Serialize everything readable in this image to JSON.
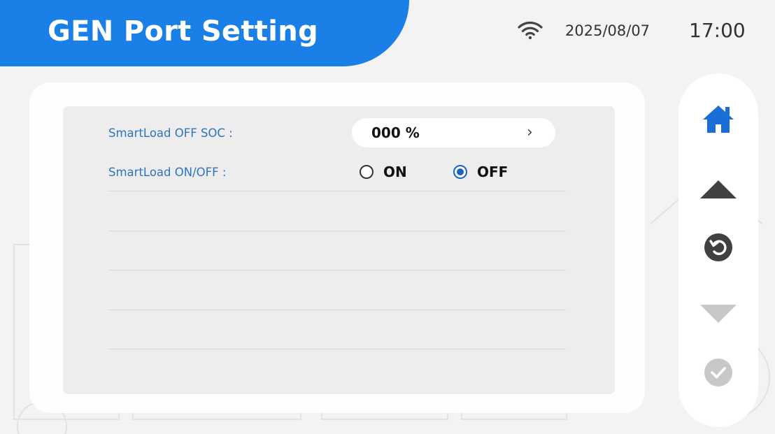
{
  "header": {
    "title": "GEN Port Setting"
  },
  "status": {
    "wifi_icon": "wifi-icon",
    "date": "2025/08/07",
    "time": "17:00"
  },
  "settings": {
    "smartload_off_soc": {
      "label": "SmartLoad OFF SOC :",
      "value": "000 %"
    },
    "smartload_onoff": {
      "label": "SmartLoad ON/OFF :",
      "options": [
        {
          "label": "ON",
          "selected": false
        },
        {
          "label": "OFF",
          "selected": true
        }
      ]
    }
  },
  "nav": {
    "home_icon": "home-icon",
    "up_icon": "triangle-up-icon",
    "back_icon": "back-icon",
    "down_icon": "triangle-down-icon",
    "confirm_icon": "check-circle-icon"
  },
  "colors": {
    "accent": "#1a7fe6",
    "label": "#2e74c4",
    "nav_dark": "#404040",
    "nav_disabled": "#c8c8c8"
  }
}
